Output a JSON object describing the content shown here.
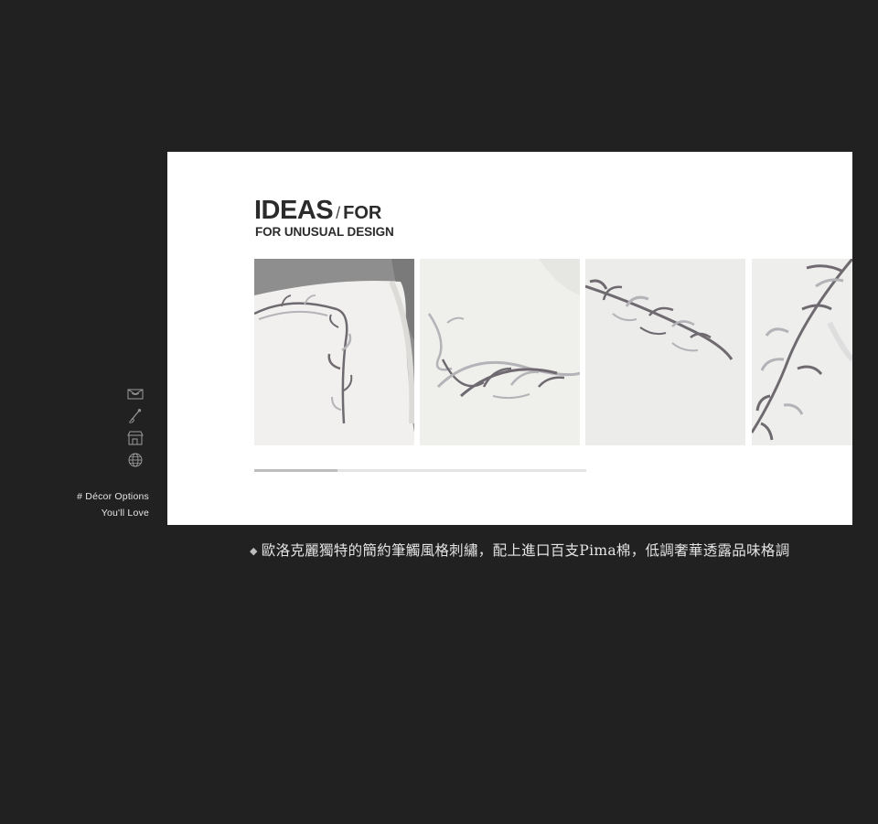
{
  "sidebar": {
    "icons": [
      "bedding-icon",
      "needle-thread-icon",
      "store-icon",
      "globe-icon"
    ],
    "caption_line1": "# Décor Options",
    "caption_line2": "You'll Love"
  },
  "panel": {
    "title_big": "IDEAS",
    "title_slash": "/",
    "title_for": "FOR",
    "subtitle": "FOR UNUSUAL DESIGN",
    "gallery": [
      {
        "name": "pillow-embroidery-corner"
      },
      {
        "name": "embroidery-swirl-closeup"
      },
      {
        "name": "embroidery-branch"
      },
      {
        "name": "embroidery-vine"
      }
    ],
    "scroll_progress": 0.25
  },
  "caption": {
    "bullet": "◆",
    "text": "歐洛克麗獨特的簡約筆觸風格刺繡，配上進口百支Pima棉，低調奢華透露品味格調"
  },
  "colors": {
    "background": "#212121",
    "panel": "#ffffff",
    "embroidery_dark": "#6f6a70",
    "embroidery_light": "#b3b3b8"
  }
}
